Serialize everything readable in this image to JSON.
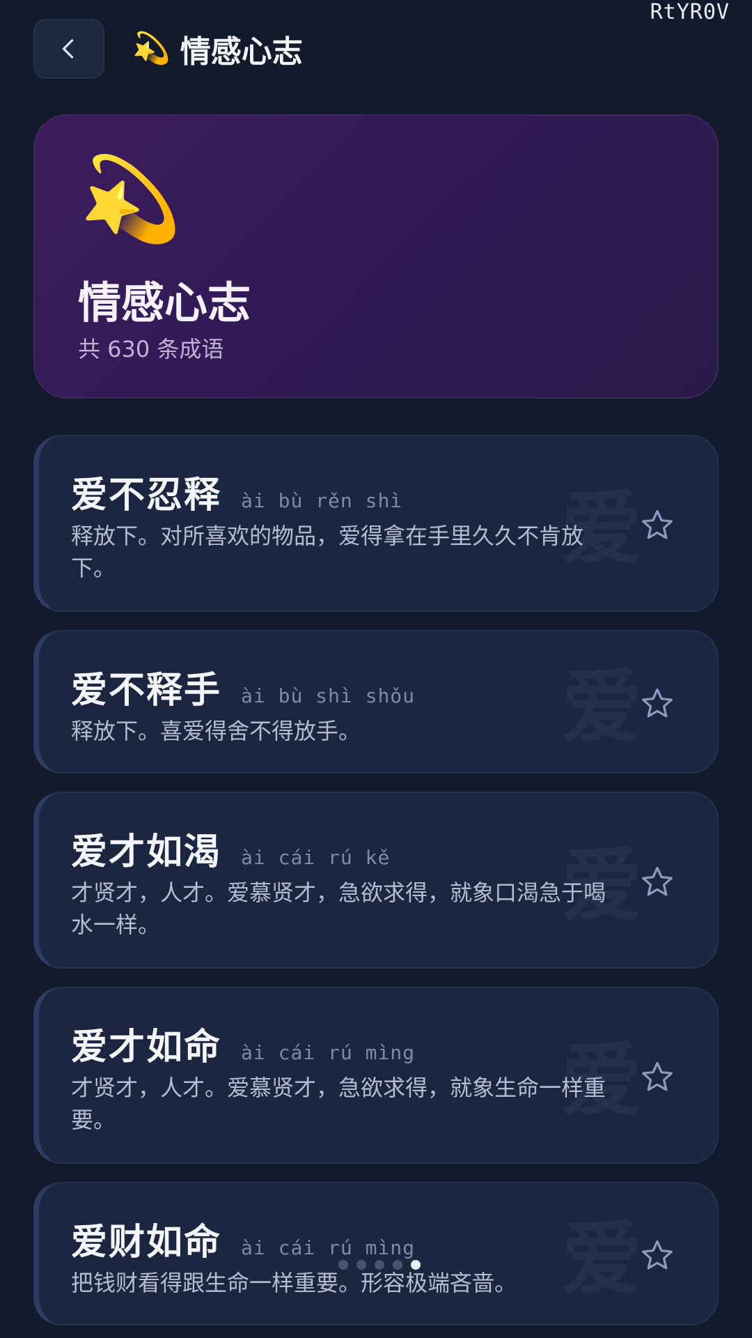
{
  "watermark": "RtYR0V",
  "header": {
    "emoji": "💫",
    "title": "情感心志"
  },
  "hero": {
    "emoji": "💫",
    "title": "情感心志",
    "count_text": "共 630 条成语"
  },
  "items": [
    {
      "title": "爱不忍释",
      "pinyin": "ài bù rěn shì",
      "desc": "释放下。对所喜欢的物品，爱得拿在手里久久不肯放下。",
      "bg_char": "爱"
    },
    {
      "title": "爱不释手",
      "pinyin": "ài bù shì shǒu",
      "desc": "释放下。喜爱得舍不得放手。",
      "bg_char": "爱"
    },
    {
      "title": "爱才如渴",
      "pinyin": "ài cái rú kě",
      "desc": "才贤才，人才。爱慕贤才，急欲求得，就象口渴急于喝水一样。",
      "bg_char": "爱"
    },
    {
      "title": "爱才如命",
      "pinyin": "ài cái rú mìng",
      "desc": "才贤才，人才。爱慕贤才，急欲求得，就象生命一样重要。",
      "bg_char": "爱"
    },
    {
      "title": "爱财如命",
      "pinyin": "ài cái rú mìng",
      "desc": "把钱财看得跟生命一样重要。形容极端吝啬。",
      "bg_char": "爱"
    }
  ],
  "pagination": {
    "total": 5,
    "active_index": 4
  },
  "colors": {
    "background": "#121a2b",
    "card": "#1c2640",
    "hero": "#3d1d5e",
    "star_outline": "#8d9bc0"
  },
  "icons": {
    "back": "chevron-left-icon",
    "favorite": "star-outline-icon"
  }
}
